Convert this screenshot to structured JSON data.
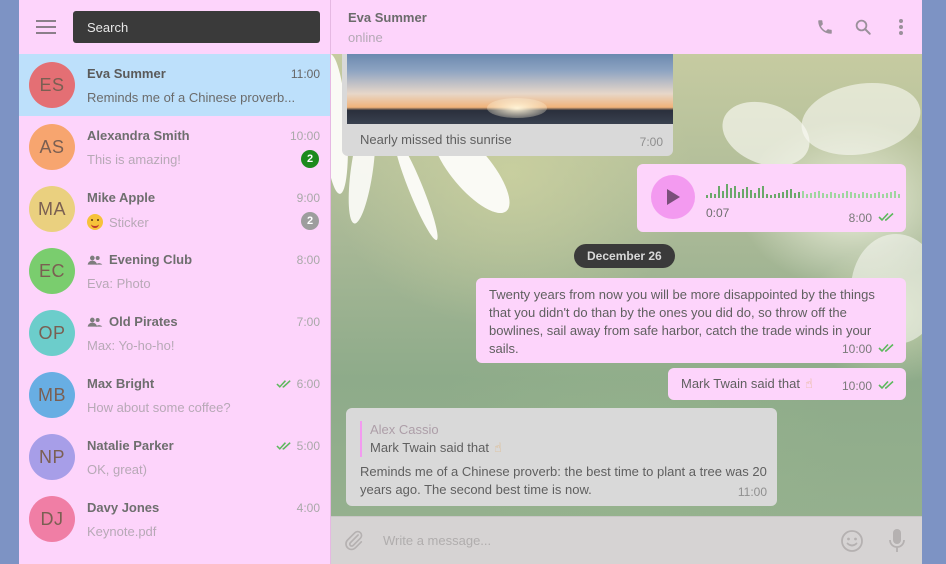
{
  "sidebar": {
    "search_placeholder": "Search",
    "chats": [
      {
        "initials": "ES",
        "name": "Eva Summer",
        "time": "11:00",
        "preview": "Reminds me of a Chinese proverb...",
        "avatar_color": "#e46f74",
        "active": true
      },
      {
        "initials": "AS",
        "name": "Alexandra Smith",
        "time": "10:00",
        "preview": "This is amazing!",
        "avatar_color": "#f7a56f",
        "badge": "2",
        "badge_color": "#1d8a1d"
      },
      {
        "initials": "MA",
        "name": "Mike Apple",
        "time": "9:00",
        "preview": "Sticker",
        "preview_icon": "grinning-emoji-icon",
        "avatar_color": "#ead07f",
        "badge": "2",
        "badge_color": "#9d9d9d"
      },
      {
        "initials": "EC",
        "name": "Evening Club",
        "time": "8:00",
        "preview": "Eva: Photo",
        "avatar_color": "#7acd6e",
        "group": true
      },
      {
        "initials": "OP",
        "name": "Old Pirates",
        "time": "7:00",
        "preview": "Max: Yo-ho-ho!",
        "avatar_color": "#6ccdcb",
        "group": true
      },
      {
        "initials": "MB",
        "name": "Max Bright",
        "time": "6:00",
        "preview": "How about some coffee?",
        "avatar_color": "#68aee3",
        "read": true
      },
      {
        "initials": "NP",
        "name": "Natalie Parker",
        "time": "5:00",
        "preview": "OK, great)",
        "avatar_color": "#a79ee8",
        "read": true
      },
      {
        "initials": "DJ",
        "name": "Davy Jones",
        "time": "4:00",
        "preview": "Keynote.pdf",
        "avatar_color": "#f07ea5"
      }
    ]
  },
  "header": {
    "name": "Eva Summer",
    "status": "online",
    "icons": [
      "phone-icon",
      "search-icon",
      "more-vertical-icon"
    ]
  },
  "messages": {
    "photo_caption": "Nearly missed this sunrise",
    "photo_time": "7:00",
    "voice_duration": "0:07",
    "voice_time": "8:00",
    "date_divider": "December 26",
    "quote_text": "Twenty years from now you will be more disappointed by the things that you didn't do than by the ones you did do, so throw off the bowlines, sail away from safe harbor, catch the trade winds in your sails.",
    "quote_time": "10:00",
    "twain_text": "Mark Twain said that",
    "twain_time": "10:00",
    "reply_author": "Alex Cassio",
    "reply_quoted": "Mark Twain said that",
    "reply_text": "Reminds me of a Chinese proverb: the best time to plant a tree was 20 years ago. The second best time is now.",
    "reply_time": "11:00"
  },
  "composer": {
    "placeholder": "Write a message..."
  },
  "colors": {
    "panel": "#fdd4fb",
    "active_chat": "#bde0fb",
    "incoming_bubble": "#d9d9d9",
    "read_ticks": "#5cb85c"
  }
}
